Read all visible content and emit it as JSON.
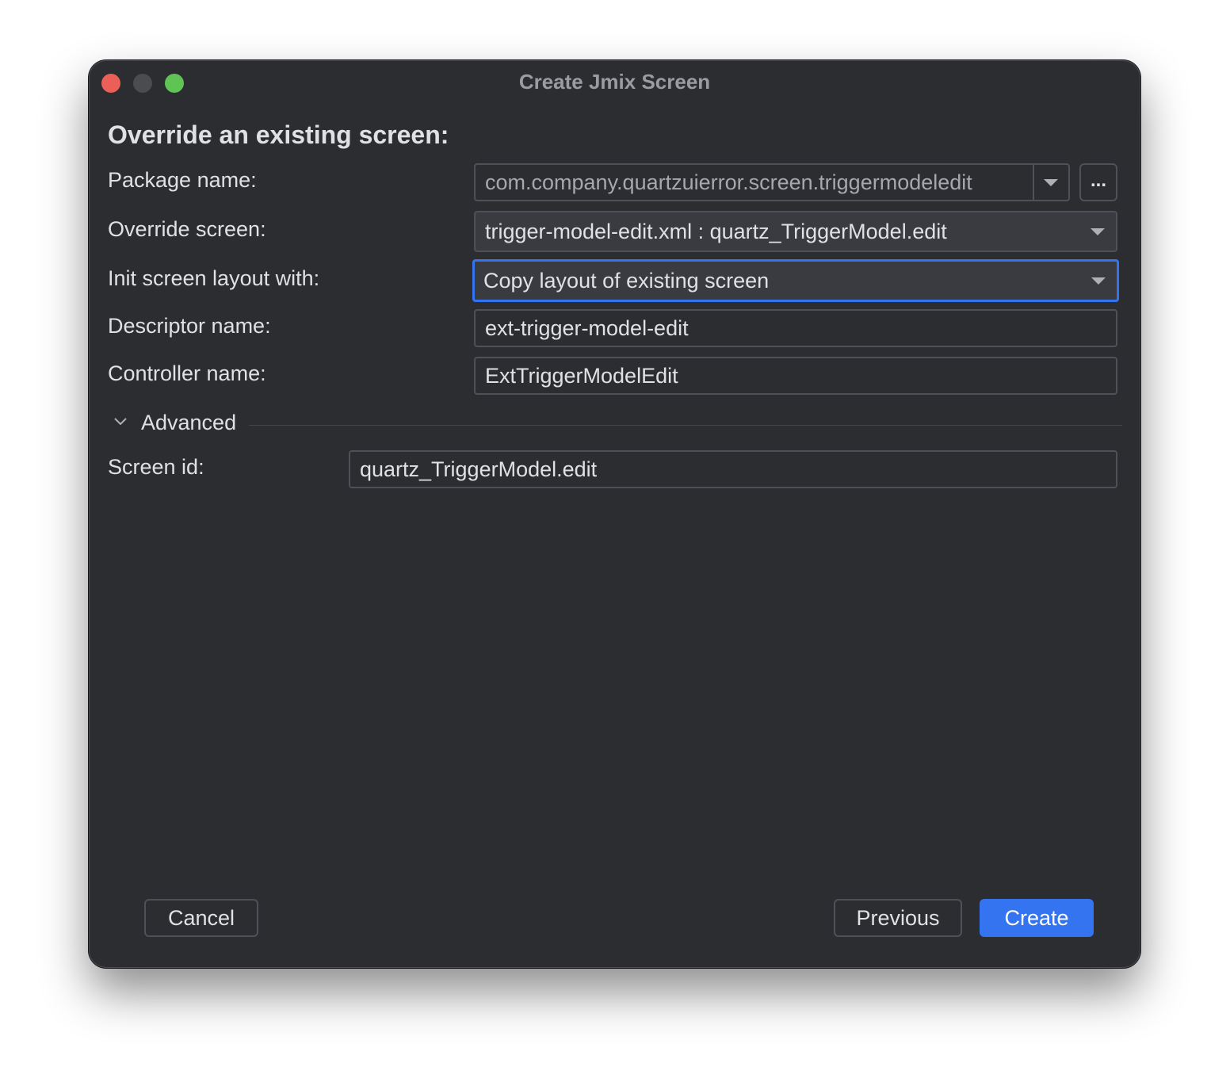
{
  "window": {
    "title": "Create Jmix Screen"
  },
  "heading": "Override an existing screen:",
  "form": {
    "package_label": "Package name:",
    "package_value": "com.company.quartzuierror.screen.triggermodeledit",
    "package_browse": "...",
    "override_label": "Override screen:",
    "override_value": "trigger-model-edit.xml : quartz_TriggerModel.edit",
    "init_label": "Init screen layout with:",
    "init_value": "Copy layout of existing screen",
    "descriptor_label": "Descriptor name:",
    "descriptor_value": "ext-trigger-model-edit",
    "controller_label": "Controller name:",
    "controller_value": "ExtTriggerModelEdit"
  },
  "advanced": {
    "label": "Advanced",
    "expanded": true,
    "screen_id_label": "Screen id:",
    "screen_id_value": "quartz_TriggerModel.edit"
  },
  "buttons": {
    "cancel": "Cancel",
    "previous": "Previous",
    "create": "Create"
  },
  "colors": {
    "background": "#2b2d30",
    "accent": "#3574f0",
    "close": "#ec5f58",
    "maximize": "#5fc454"
  },
  "icons": [
    "close-window-icon",
    "minimize-window-icon",
    "maximize-window-icon",
    "chevron-down-icon",
    "dropdown-arrow-icon"
  ]
}
